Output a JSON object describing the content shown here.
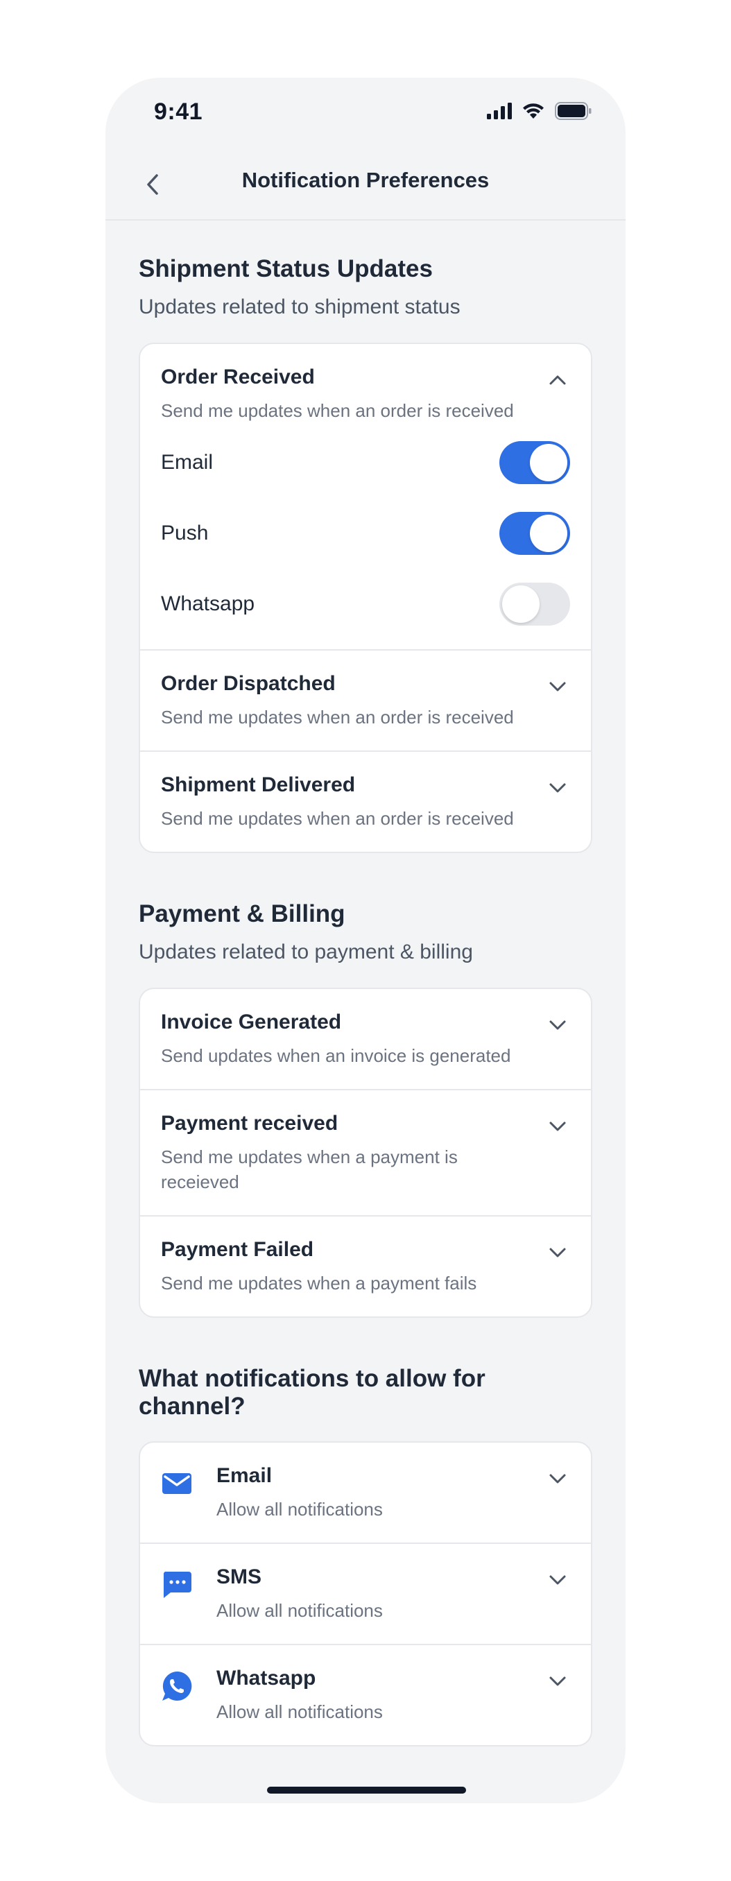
{
  "status_bar": {
    "time": "9:41"
  },
  "header": {
    "title": "Notification Preferences"
  },
  "shipment": {
    "title": "Shipment Status Updates",
    "subtitle": "Updates related to shipment status",
    "expanded": {
      "title": "Order Received",
      "desc": "Send me updates when an order is received",
      "toggles": [
        {
          "label": "Email",
          "on": true
        },
        {
          "label": "Push",
          "on": true
        },
        {
          "label": "Whatsapp",
          "on": false
        }
      ]
    },
    "items": [
      {
        "title": "Order Dispatched",
        "desc": "Send me updates when an order is received"
      },
      {
        "title": "Shipment Delivered",
        "desc": "Send me updates when an order is received"
      }
    ]
  },
  "payment": {
    "title": "Payment & Billing",
    "subtitle": "Updates related to payment & billing",
    "items": [
      {
        "title": "Invoice Generated",
        "desc": "Send updates when an invoice is generated"
      },
      {
        "title": "Payment received",
        "desc": "Send me updates when a payment is receieved"
      },
      {
        "title": "Payment Failed",
        "desc": "Send me updates when a payment fails"
      }
    ]
  },
  "channels": {
    "title": "What notifications to allow for channel?",
    "items": [
      {
        "name": "Email",
        "desc": "Allow all notifications",
        "icon": "email-icon"
      },
      {
        "name": "SMS",
        "desc": "Allow all notifications",
        "icon": "sms-icon"
      },
      {
        "name": "Whatsapp",
        "desc": "Allow all notifications",
        "icon": "whatsapp-icon"
      }
    ]
  },
  "colors": {
    "accent": "#2f6fe4",
    "background": "#f3f4f6",
    "card": "#ffffff",
    "divider": "#e5e7eb"
  }
}
